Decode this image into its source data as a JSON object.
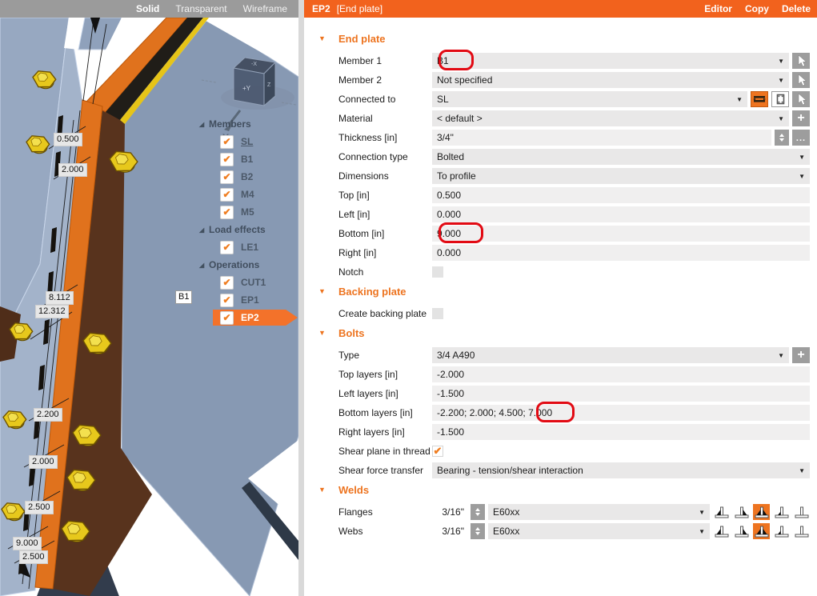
{
  "toolbar": {
    "modes": [
      "Solid",
      "Transparent",
      "Wireframe"
    ],
    "active_mode": "Solid"
  },
  "header": {
    "title": "EP2",
    "subtitle": "[End plate]",
    "actions": [
      "Editor",
      "Copy",
      "Delete"
    ]
  },
  "colors": {
    "accent_orange": "#f2621d",
    "section_orange": "#ed7420",
    "annotation_red": "#e20a13",
    "steel_blue": "#8799b3",
    "plate_orange": "#e0721d",
    "bolt_yellow": "#e7c81c"
  },
  "viewport": {
    "member_tag": "B1",
    "dimension_labels": [
      "0.500",
      "2.000",
      "8.112",
      "12.312",
      "2.200",
      "2.000",
      "2.500",
      "9.000",
      "2.500"
    ],
    "view_cube": {
      "front": "+Y",
      "right": "Z",
      "top": "-X",
      "axis": "Y"
    },
    "tree": {
      "groups": [
        {
          "label": "Members",
          "items": [
            {
              "label": "SL",
              "checked": true,
              "underlined": true
            },
            {
              "label": "B1",
              "checked": true
            },
            {
              "label": "B2",
              "checked": true
            },
            {
              "label": "M4",
              "checked": true
            },
            {
              "label": "M5",
              "checked": true
            }
          ]
        },
        {
          "label": "Load effects",
          "items": [
            {
              "label": "LE1",
              "checked": true
            }
          ]
        },
        {
          "label": "Operations",
          "items": [
            {
              "label": "CUT1",
              "checked": true
            },
            {
              "label": "EP1",
              "checked": true
            },
            {
              "label": "EP2",
              "checked": true,
              "selected": true
            }
          ]
        }
      ]
    }
  },
  "panel": {
    "sections": [
      {
        "title": "End plate",
        "rows": [
          {
            "slug": "member-1",
            "label": "Member 1",
            "value": "B1",
            "type": "combo",
            "buttons": [
              "cursor"
            ],
            "annotated": true
          },
          {
            "slug": "member-2",
            "label": "Member 2",
            "value": "Not specified",
            "type": "combo",
            "buttons": [
              "cursor"
            ]
          },
          {
            "slug": "connected-to",
            "label": "Connected to",
            "value": "SL",
            "type": "combo",
            "buttons": [
              "plate-horizontal",
              "plate-vertical",
              "cursor"
            ]
          },
          {
            "slug": "material",
            "label": "Material",
            "value": "< default >",
            "type": "combo",
            "buttons": [
              "plus"
            ]
          },
          {
            "slug": "thickness",
            "label": "Thickness [in]",
            "value": "3/4\"",
            "type": "value",
            "buttons": [
              "spinner",
              "dots"
            ]
          },
          {
            "slug": "connection-type",
            "label": "Connection type",
            "value": "Bolted",
            "type": "combo"
          },
          {
            "slug": "dimensions",
            "label": "Dimensions",
            "value": "To profile",
            "type": "combo"
          },
          {
            "slug": "top",
            "label": "Top [in]",
            "value": "0.500",
            "type": "value"
          },
          {
            "slug": "left",
            "label": "Left [in]",
            "value": "0.000",
            "type": "value"
          },
          {
            "slug": "bottom",
            "label": "Bottom [in]",
            "value": "9.000",
            "type": "value",
            "annotated": true
          },
          {
            "slug": "right",
            "label": "Right [in]",
            "value": "0.000",
            "type": "value"
          },
          {
            "slug": "notch",
            "label": "Notch",
            "type": "checkbox",
            "checked": false
          }
        ]
      },
      {
        "title": "Backing plate",
        "rows": [
          {
            "slug": "create-backing-plate",
            "label": "Create backing plate",
            "type": "checkbox",
            "checked": false
          }
        ]
      },
      {
        "title": "Bolts",
        "rows": [
          {
            "slug": "type",
            "label": "Type",
            "value": "3/4 A490",
            "type": "combo",
            "buttons": [
              "plus"
            ]
          },
          {
            "slug": "top-layers",
            "label": "Top layers [in]",
            "value": "-2.000",
            "type": "value"
          },
          {
            "slug": "left-layers",
            "label": "Left layers [in]",
            "value": "-1.500",
            "type": "value"
          },
          {
            "slug": "bottom-layers",
            "label": "Bottom layers [in]",
            "value": "-2.200; 2.000; 4.500; 7.000",
            "type": "value",
            "annotated": true
          },
          {
            "slug": "right-layers",
            "label": "Right layers [in]",
            "value": "-1.500",
            "type": "value"
          },
          {
            "slug": "shear-plane-in-thread",
            "label": "Shear plane in thread",
            "type": "checkbox",
            "checked": true
          },
          {
            "slug": "shear-force-transfer",
            "label": "Shear force transfer",
            "value": "Bearing - tension/shear interaction",
            "type": "combo"
          }
        ]
      },
      {
        "title": "Welds",
        "rows": [
          {
            "slug": "flanges",
            "label": "Flanges",
            "size": "3/16\"",
            "value": "E60xx",
            "type": "weld",
            "selected_weld": 3
          },
          {
            "slug": "webs",
            "label": "Webs",
            "size": "3/16\"",
            "value": "E60xx",
            "type": "weld",
            "selected_weld": 3
          }
        ]
      }
    ]
  }
}
